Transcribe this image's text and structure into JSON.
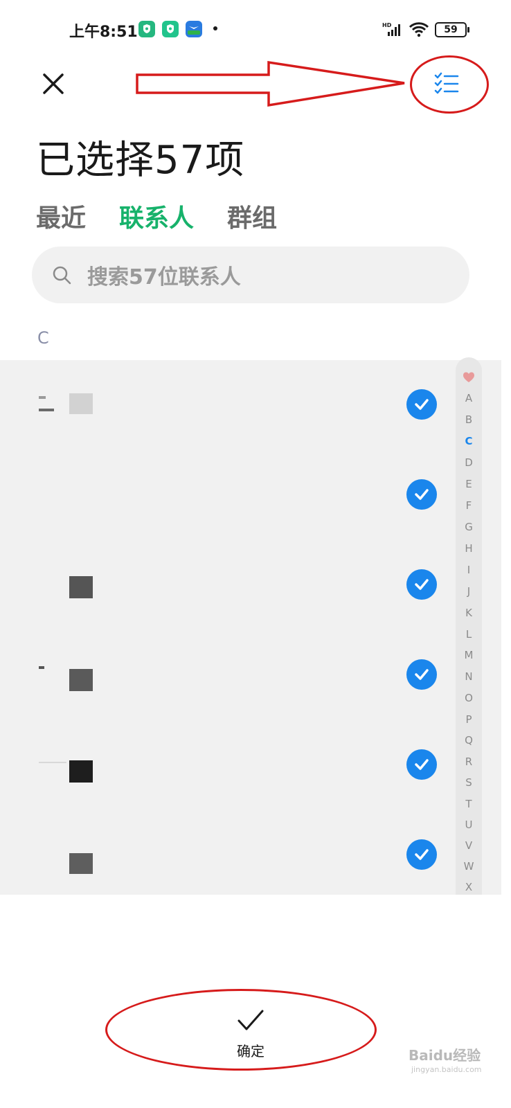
{
  "status_bar": {
    "time": "上午8:51",
    "battery": "59",
    "network_label": "HD"
  },
  "header": {
    "title": "已选择57项"
  },
  "tabs": [
    {
      "label": "最近",
      "active": false
    },
    {
      "label": "联系人",
      "active": true
    },
    {
      "label": "群组",
      "active": false
    }
  ],
  "search": {
    "placeholder": "搜索57位联系人"
  },
  "section_letter": "C",
  "contacts": [
    {
      "selected": true
    },
    {
      "selected": true
    },
    {
      "selected": true
    },
    {
      "selected": true
    },
    {
      "selected": true
    },
    {
      "selected": true
    }
  ],
  "alpha_index": [
    "A",
    "B",
    "C",
    "D",
    "E",
    "F",
    "G",
    "H",
    "I",
    "J",
    "K",
    "L",
    "M",
    "N",
    "O",
    "P",
    "Q",
    "R",
    "S",
    "T",
    "U",
    "V",
    "W",
    "X"
  ],
  "alpha_active": "C",
  "confirm": {
    "label": "确定"
  },
  "watermark": {
    "brand": "Baidu经验",
    "url": "jingyan.baidu.com"
  },
  "colors": {
    "accent_green": "#17b26b",
    "check_blue": "#1a86ec",
    "annotation_red": "#d61b1b"
  }
}
